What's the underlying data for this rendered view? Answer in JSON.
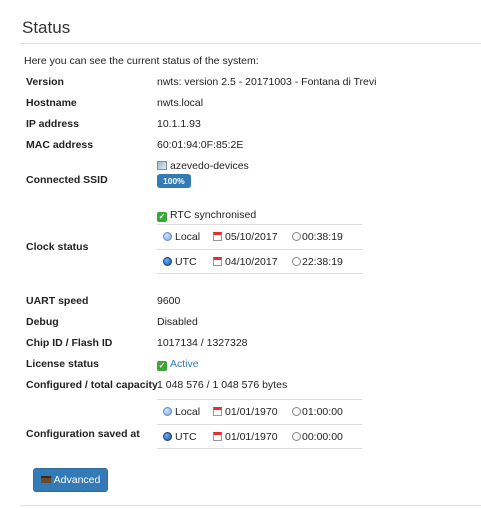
{
  "page": {
    "title": "Status",
    "intro": "Here you can see the current status of the system:"
  },
  "rows": {
    "version": {
      "label": "Version",
      "value": "nwts: version 2.5 - 20171003 - Fontana di Trevi"
    },
    "hostname": {
      "label": "Hostname",
      "value": "nwts.local"
    },
    "ip": {
      "label": "IP address",
      "value": "10.1.1.93"
    },
    "mac": {
      "label": "MAC address",
      "value": "60:01:94:0F:85:2E"
    },
    "ssid": {
      "label": "Connected SSID",
      "value": "azevedo-devices",
      "signal": "100%"
    },
    "clock": {
      "label": "Clock status",
      "sync": "RTC synchronised",
      "local": {
        "zone": "Local",
        "date": "05/10/2017",
        "time": "00:38:19"
      },
      "utc": {
        "zone": "UTC",
        "date": "04/10/2017",
        "time": "22:38:19"
      }
    },
    "uart": {
      "label": "UART speed",
      "value": "9600"
    },
    "debug": {
      "label": "Debug",
      "value": "Disabled"
    },
    "chip": {
      "label": "Chip ID / Flash ID",
      "value": "1017134 / 1327328"
    },
    "license": {
      "label": "License status",
      "value": "Active"
    },
    "capacity": {
      "label": "Configured / total capacity",
      "value": "1 048 576 / 1 048 576 bytes"
    },
    "config_saved": {
      "label": "Configuration saved at",
      "local": {
        "zone": "Local",
        "date": "01/01/1970",
        "time": "01:00:00"
      },
      "utc": {
        "zone": "UTC",
        "date": "01/01/1970",
        "time": "00:00:00"
      }
    }
  },
  "actions": {
    "advanced_label": "Advanced"
  },
  "colors": {
    "accent": "#337ab7",
    "ok": "#3aa635",
    "link": "#337ab7"
  },
  "icons": {
    "ssid": "wifi-icon",
    "sync": "check-icon",
    "local": "globe-icon",
    "utc": "earth-icon",
    "date": "calendar-icon",
    "time": "clock-icon",
    "advanced": "toolbox-icon"
  }
}
